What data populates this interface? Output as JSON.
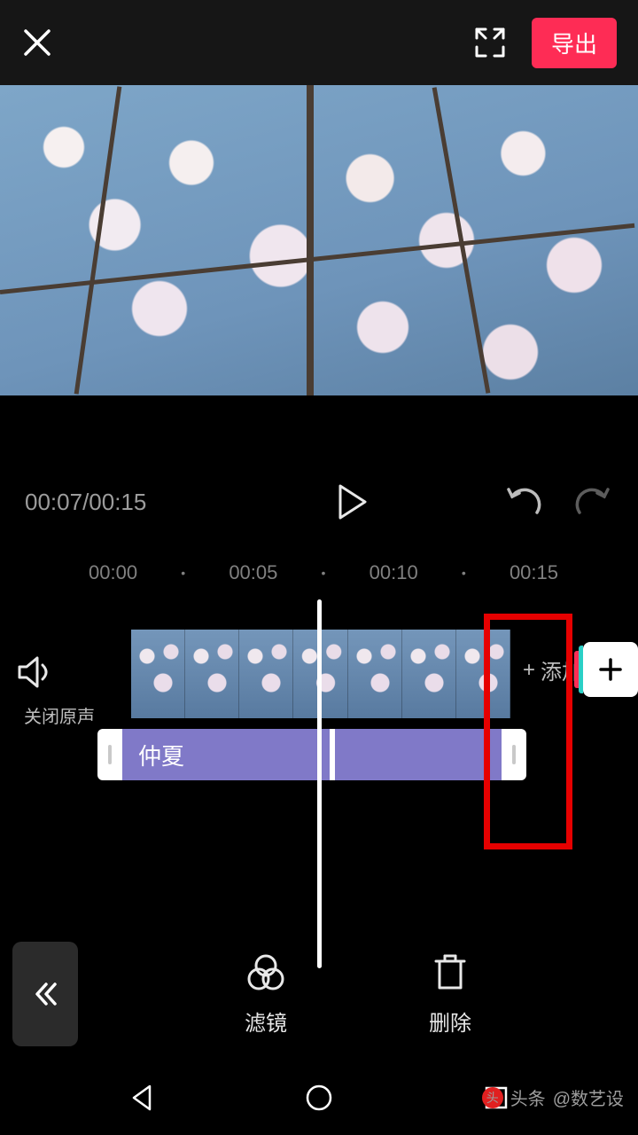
{
  "header": {
    "export_label": "导出"
  },
  "playback": {
    "current_time": "00:07",
    "total_time": "00:15",
    "time_display": "00:07/00:15"
  },
  "ruler": {
    "marks": [
      "00:00",
      "00:05",
      "00:10",
      "00:15"
    ]
  },
  "mute": {
    "label": "关闭原声"
  },
  "audio_track": {
    "name": "仲夏"
  },
  "add_clip": {
    "label": "添加",
    "plus": "+"
  },
  "tools": {
    "filter": "滤镜",
    "delete": "删除"
  },
  "footer": {
    "prefix": "头条",
    "author": "@数艺设"
  },
  "colors": {
    "accent": "#fe2c55",
    "track": "#8079c8",
    "highlight": "#e60000"
  }
}
